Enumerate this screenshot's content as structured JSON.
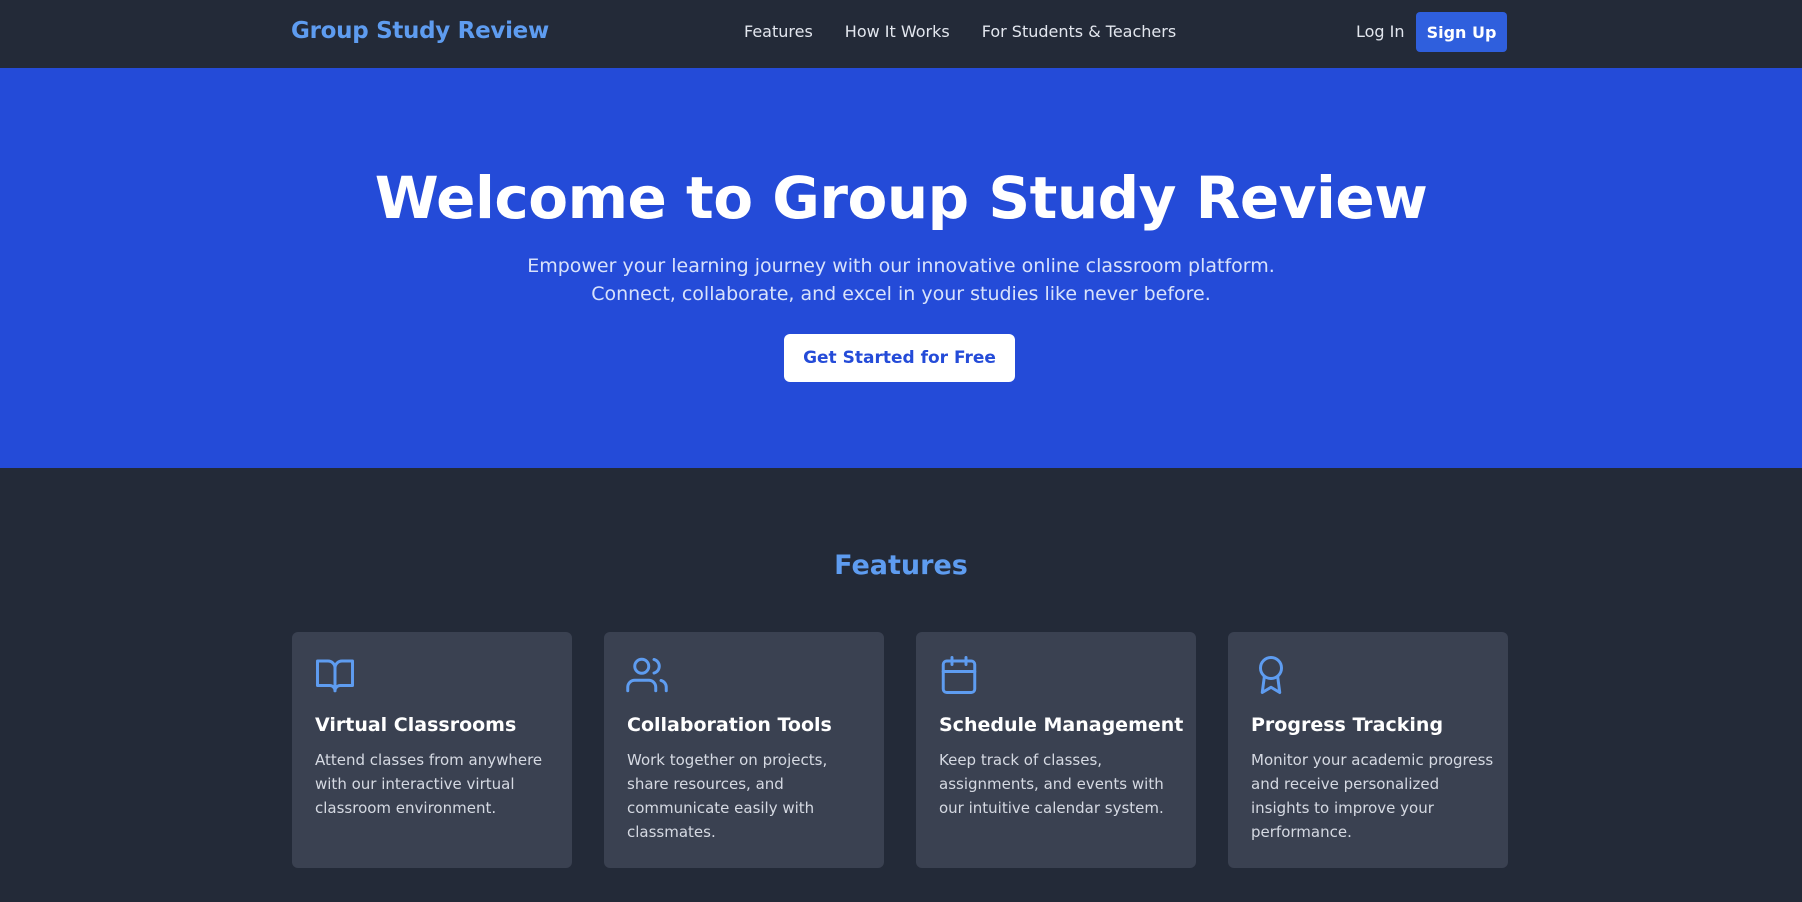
{
  "nav": {
    "brand": "Group Study Review",
    "links": [
      "Features",
      "How It Works",
      "For Students & Teachers"
    ],
    "login": "Log In",
    "signup": "Sign Up"
  },
  "hero": {
    "title": "Welcome to Group Study Review",
    "subtitle_line1": "Empower your learning journey with our innovative online classroom platform.",
    "subtitle_line2": "Connect, collaborate, and excel in your studies like never before.",
    "cta": "Get Started for Free"
  },
  "features": {
    "heading": "Features",
    "cards": [
      {
        "icon": "book-open-icon",
        "title": "Virtual Classrooms",
        "description": "Attend classes from anywhere with our interactive virtual classroom environment."
      },
      {
        "icon": "users-icon",
        "title": "Collaboration Tools",
        "description": "Work together on projects, share resources, and communicate easily with classmates."
      },
      {
        "icon": "calendar-icon",
        "title": "Schedule Management",
        "description": "Keep track of classes, assignments, and events with our intuitive calendar system."
      },
      {
        "icon": "award-icon",
        "title": "Progress Tracking",
        "description": "Monitor your academic progress and receive personalized insights to improve your performance."
      }
    ]
  },
  "colors": {
    "background": "#232a38",
    "hero": "#244bd8",
    "accent": "#5e9cf0",
    "card": "#3a4151",
    "signup_button": "#2f5fdd"
  }
}
